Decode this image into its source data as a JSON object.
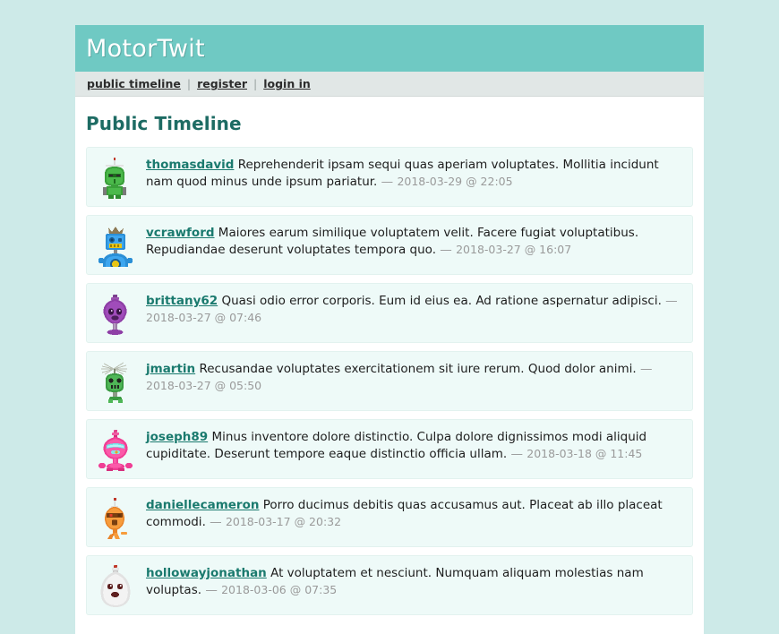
{
  "site": {
    "title": "MotorTwit",
    "brand_color": "#6fc9c3",
    "background_color": "#cdeae8",
    "link_color": "#1a7a6e",
    "heading_color": "#1d6b63"
  },
  "nav": {
    "separator": "|",
    "items": [
      {
        "label": "public timeline",
        "name": "nav-public-timeline"
      },
      {
        "label": "register",
        "name": "nav-register"
      },
      {
        "label": "login in",
        "name": "nav-login-in"
      }
    ]
  },
  "main": {
    "page_title": "Public Timeline"
  },
  "timeline": {
    "entries": [
      {
        "username": "thomasdavid",
        "text": "Reprehenderit ipsam sequi quas aperiam voluptates. Mollitia incidunt nam quod minus unde ipsum pariatur.",
        "separator": "—",
        "timestamp": "2018-03-29 @ 22:05",
        "avatar": "robot-green-antenna"
      },
      {
        "username": "vcrawford",
        "text": "Maiores earum similique voluptatem velit. Facere fugiat voluptatibus. Repudiandae deserunt voluptates tempora quo.",
        "separator": "—",
        "timestamp": "2018-03-27 @ 16:07",
        "avatar": "robot-blue-box"
      },
      {
        "username": "brittany62",
        "text": "Quasi odio error corporis. Eum id eius ea. Ad ratione aspernatur adipisci.",
        "separator": "—",
        "timestamp": "2018-03-27 @ 07:46",
        "avatar": "robot-purple-bulb"
      },
      {
        "username": "jmartin",
        "text": "Recusandae voluptates exercitationem sit iure rerum. Quod dolor animi.",
        "separator": "—",
        "timestamp": "2018-03-27 @ 05:50",
        "avatar": "robot-green-dish"
      },
      {
        "username": "joseph89",
        "text": "Minus inventore dolore distinctio. Culpa dolore dignissimos modi aliquid cupiditate. Deserunt tempore eaque distinctio officia ullam.",
        "separator": "—",
        "timestamp": "2018-03-18 @ 11:45",
        "avatar": "robot-pink-visor"
      },
      {
        "username": "daniellecameron",
        "text": "Porro ducimus debitis quas accusamus aut. Placeat ab illo placeat commodi.",
        "separator": "—",
        "timestamp": "2018-03-17 @ 20:32",
        "avatar": "robot-orange-oval"
      },
      {
        "username": "hollowayjonathan",
        "text": "At voluptatem et nesciunt. Numquam aliquam molestias nam voluptas.",
        "separator": "—",
        "timestamp": "2018-03-06 @ 07:35",
        "avatar": "robot-white-dome"
      }
    ]
  }
}
